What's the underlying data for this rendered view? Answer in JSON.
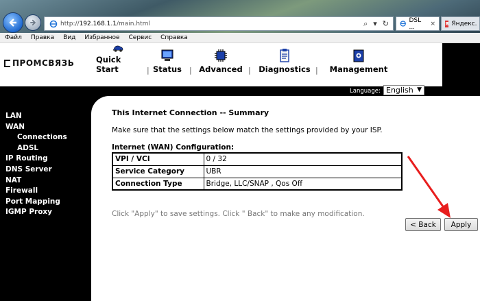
{
  "browser": {
    "url_prefix": "http://",
    "url_host": "192.168.1.1",
    "url_path": "/main.html",
    "search_symbol": "⌕",
    "tabs": [
      {
        "label": "DSL ...",
        "close": "×"
      },
      {
        "label": "Яндекс."
      }
    ],
    "menu": [
      "Файл",
      "Правка",
      "Вид",
      "Избранное",
      "Сервис",
      "Справка"
    ]
  },
  "router": {
    "brand": "ПРОМСВЯЗЬ",
    "top_nav": [
      {
        "label": "Quick Start",
        "icon": "car-icon"
      },
      {
        "label": "Status",
        "icon": "monitor-icon"
      },
      {
        "label": "Advanced",
        "icon": "chip-icon"
      },
      {
        "label": "Diagnostics",
        "icon": "clipboard-icon"
      },
      {
        "label": "Management",
        "icon": "book-icon"
      }
    ],
    "separator": "|",
    "language_label": "Language:",
    "language_value": "English",
    "sidebar": [
      {
        "label": "LAN"
      },
      {
        "label": "WAN"
      },
      {
        "label": "Connections",
        "sub": true
      },
      {
        "label": "ADSL",
        "sub": true
      },
      {
        "label": "IP Routing"
      },
      {
        "label": "DNS Server"
      },
      {
        "label": "NAT"
      },
      {
        "label": "Firewall"
      },
      {
        "label": "Port Mapping"
      },
      {
        "label": "IGMP Proxy"
      }
    ]
  },
  "summary": {
    "title": "This Internet Connection -- Summary",
    "description": "Make sure that the settings below match the settings provided by your ISP.",
    "config_title": "Internet (WAN) Configuration:",
    "rows": [
      {
        "label": "VPI / VCI",
        "value": "0 / 32"
      },
      {
        "label": "Service Category",
        "value": "UBR"
      },
      {
        "label": "Connection Type",
        "value": "Bridge, LLC/SNAP , Qos Off"
      }
    ],
    "hint": "Click \"Apply\" to save settings. Click \" Back\" to make any modification."
  },
  "buttons": {
    "back": "< Back",
    "apply": "Apply"
  },
  "colors": {
    "arrow": "#e81e1e",
    "sidebar_bg": "#000000",
    "hint_text": "#777777"
  }
}
